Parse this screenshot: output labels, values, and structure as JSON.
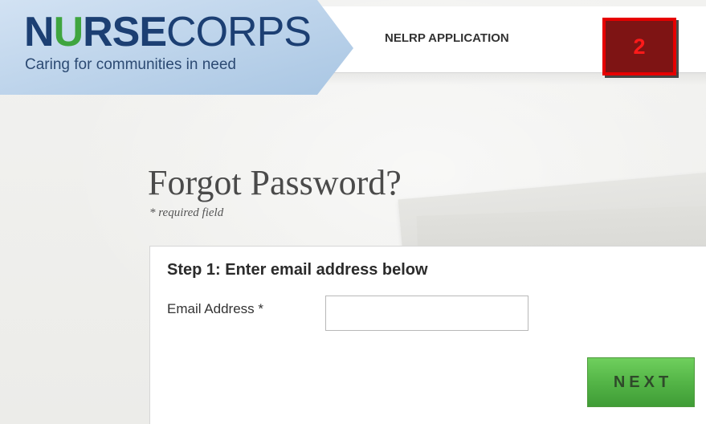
{
  "header": {
    "logo": {
      "title_bold": "N",
      "title_mark": "U",
      "title_bold_rest": "RSE",
      "title_light": "CORPS",
      "tagline": "Caring for communities in need"
    },
    "nav_link": "NELRP APPLICATION",
    "step_badge": "2"
  },
  "main": {
    "title": "Forgot Password?",
    "required_note": "* required field",
    "form": {
      "step_heading": "Step 1: Enter email address below",
      "email_label": "Email Address *",
      "email_value": "",
      "next_label": "NEXT"
    }
  },
  "colors": {
    "brand_navy": "#1c3f73",
    "logo_panel": "#bcd3ea",
    "next_button": "#54b547",
    "badge_fill": "#7e1414",
    "badge_border": "#e60000"
  },
  "icons": {
    "logo_mark": "nurse-corps-shield-icon"
  }
}
